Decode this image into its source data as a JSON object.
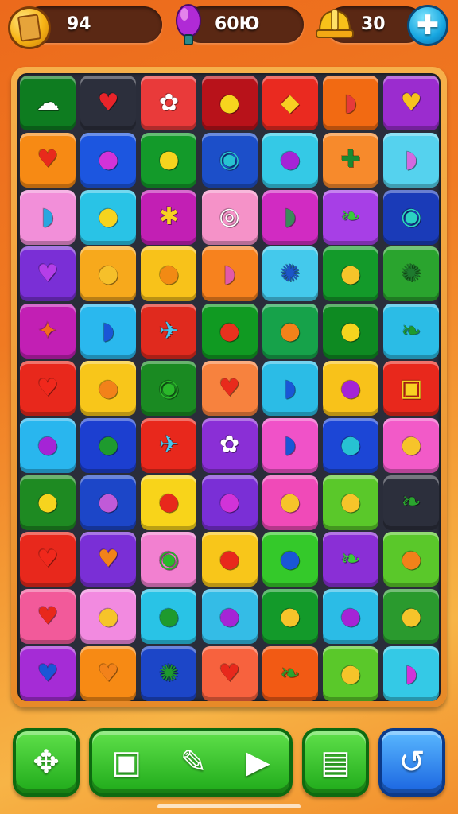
{
  "hud": {
    "coins": "94",
    "gems": "60Ю",
    "helmets": "30",
    "icons": {
      "coins": "gold-coin-icon",
      "gems": "purple-gem-icon",
      "helmets": "hard-hat-icon",
      "add": "plus-icon"
    }
  },
  "board": {
    "rows": 11,
    "cols": 7,
    "tiles": [
      [
        {
          "bg": "#0e7c20",
          "piece": "☁",
          "fg": "#ffffff"
        },
        {
          "bg": "#2c2f3c",
          "piece": "♥",
          "fg": "#e8242a"
        },
        {
          "bg": "#e93a3a",
          "piece": "✿",
          "fg": "#ffffff"
        },
        {
          "bg": "#b8121a",
          "piece": "●",
          "fg": "#f6d41e"
        },
        {
          "bg": "#ea2a20",
          "piece": "◆",
          "fg": "#f8d022"
        },
        {
          "bg": "#f26a12",
          "piece": "◗",
          "fg": "#e63a3a"
        },
        {
          "bg": "#9b2ccf",
          "piece": "♥",
          "fg": "#f7c21e"
        }
      ],
      [
        {
          "bg": "#f78a14",
          "piece": "♥",
          "fg": "#e82a1c"
        },
        {
          "bg": "#1c56e0",
          "piece": "●",
          "fg": "#d233d8"
        },
        {
          "bg": "#139a2a",
          "piece": "●",
          "fg": "#f6d41e"
        },
        {
          "bg": "#1c4fc9",
          "piece": "◉",
          "fg": "#27c2d2"
        },
        {
          "bg": "#34c9e6",
          "piece": "●",
          "fg": "#a524d6"
        },
        {
          "bg": "#f78a2c",
          "piece": "✚",
          "fg": "#1c8a32"
        },
        {
          "bg": "#55d2ee",
          "piece": "◗",
          "fg": "#d26ae0"
        }
      ],
      [
        {
          "bg": "#f28fd9",
          "piece": "◗",
          "fg": "#28a6e0"
        },
        {
          "bg": "#29c3e6",
          "piece": "●",
          "fg": "#f6d41e"
        },
        {
          "bg": "#c21fb4",
          "piece": "✱",
          "fg": "#f8d022"
        },
        {
          "bg": "#f592c8",
          "piece": "◎",
          "fg": "#ffffff"
        },
        {
          "bg": "#d12bc2",
          "piece": "◗",
          "fg": "#3a8a5a"
        },
        {
          "bg": "#a73fe6",
          "piece": "❧",
          "fg": "#3aca3a"
        },
        {
          "bg": "#1a3bb8",
          "piece": "◉",
          "fg": "#2bd2c2"
        }
      ],
      [
        {
          "bg": "#7a2fd6",
          "piece": "♥",
          "fg": "#b53ee8"
        },
        {
          "bg": "#f7a91c",
          "piece": "●",
          "fg": "#f6c02a"
        },
        {
          "bg": "#f8c21a",
          "piece": "●",
          "fg": "#f28a14"
        },
        {
          "bg": "#f7821e",
          "piece": "◗",
          "fg": "#e25aa8"
        },
        {
          "bg": "#44c9ec",
          "piece": "✺",
          "fg": "#1c56c8"
        },
        {
          "bg": "#139a2a",
          "piece": "●",
          "fg": "#f6c42a"
        },
        {
          "bg": "#2aa42e",
          "piece": "✺",
          "fg": "#1e7a2e"
        }
      ],
      [
        {
          "bg": "#c21fb4",
          "piece": "✦",
          "fg": "#f26a1e"
        },
        {
          "bg": "#2ab8ee",
          "piece": "◗",
          "fg": "#1a56d6"
        },
        {
          "bg": "#e02a1e",
          "piece": "✈",
          "fg": "#46c8f0"
        },
        {
          "bg": "#109a22",
          "piece": "●",
          "fg": "#e8321e"
        },
        {
          "bg": "#16a24a",
          "piece": "●",
          "fg": "#f2821a"
        },
        {
          "bg": "#0e8a22",
          "piece": "●",
          "fg": "#f6d41e"
        },
        {
          "bg": "#2bbce6",
          "piece": "❧",
          "fg": "#1e9a2e"
        }
      ],
      [
        {
          "bg": "#e8281c",
          "piece": "♥",
          "fg": "#f0281c"
        },
        {
          "bg": "#f8c61a",
          "piece": "●",
          "fg": "#f2821a"
        },
        {
          "bg": "#1a8a22",
          "piece": "◉",
          "fg": "#2ab82a"
        },
        {
          "bg": "#f7823e",
          "piece": "♥",
          "fg": "#e82a1c"
        },
        {
          "bg": "#2bbce6",
          "piece": "◗",
          "fg": "#1a56d6"
        },
        {
          "bg": "#f8c21a",
          "piece": "●",
          "fg": "#a524d6"
        },
        {
          "bg": "#e8281c",
          "piece": "▣",
          "fg": "#f8d022"
        }
      ],
      [
        {
          "bg": "#29b6ee",
          "piece": "●",
          "fg": "#a524d6"
        },
        {
          "bg": "#1c3fd0",
          "piece": "●",
          "fg": "#1e9a2e"
        },
        {
          "bg": "#e8281c",
          "piece": "✈",
          "fg": "#46c8f0"
        },
        {
          "bg": "#8a2fd6",
          "piece": "✿",
          "fg": "#ffffff"
        },
        {
          "bg": "#f052c8",
          "piece": "◗",
          "fg": "#1a56d6"
        },
        {
          "bg": "#1c46d6",
          "piece": "●",
          "fg": "#27c2d2"
        },
        {
          "bg": "#f25ac8",
          "piece": "●",
          "fg": "#f6c42a"
        }
      ],
      [
        {
          "bg": "#1e8a22",
          "piece": "●",
          "fg": "#f6d41e"
        },
        {
          "bg": "#1c46c8",
          "piece": "●",
          "fg": "#c05ad8"
        },
        {
          "bg": "#f8d41a",
          "piece": "●",
          "fg": "#e8281c"
        },
        {
          "bg": "#7a2fd6",
          "piece": "●",
          "fg": "#d233d8"
        },
        {
          "bg": "#f04ab8",
          "piece": "●",
          "fg": "#f6c42a"
        },
        {
          "bg": "#5ac82a",
          "piece": "●",
          "fg": "#f6c42a"
        },
        {
          "bg": "#2c2f3c",
          "piece": "❧",
          "fg": "#2aa42e"
        }
      ],
      [
        {
          "bg": "#e8281c",
          "piece": "♥",
          "fg": "#f0281c"
        },
        {
          "bg": "#7a2fd6",
          "piece": "♥",
          "fg": "#f2821a"
        },
        {
          "bg": "#f280d0",
          "piece": "◉",
          "fg": "#2ab82a"
        },
        {
          "bg": "#f8c61a",
          "piece": "●",
          "fg": "#e8281c"
        },
        {
          "bg": "#34c92a",
          "piece": "●",
          "fg": "#1a56d6"
        },
        {
          "bg": "#8a2fd6",
          "piece": "❧",
          "fg": "#3aca3a"
        },
        {
          "bg": "#5ac82a",
          "piece": "●",
          "fg": "#f2821a"
        }
      ],
      [
        {
          "bg": "#f25a9a",
          "piece": "♥",
          "fg": "#e8281c"
        },
        {
          "bg": "#f28ae0",
          "piece": "●",
          "fg": "#f6c42a"
        },
        {
          "bg": "#29c3e6",
          "piece": "●",
          "fg": "#1e9a2e"
        },
        {
          "bg": "#34bce6",
          "piece": "●",
          "fg": "#a524d6"
        },
        {
          "bg": "#139a2a",
          "piece": "●",
          "fg": "#f6c42a"
        },
        {
          "bg": "#2bbce6",
          "piece": "●",
          "fg": "#a524d6"
        },
        {
          "bg": "#2a9a2e",
          "piece": "●",
          "fg": "#f6c42a"
        }
      ],
      [
        {
          "bg": "#a52cd6",
          "piece": "♥",
          "fg": "#1a56d6"
        },
        {
          "bg": "#f78a14",
          "piece": "♥",
          "fg": "#f2821a"
        },
        {
          "bg": "#1c46c8",
          "piece": "✺",
          "fg": "#1e9a2e"
        },
        {
          "bg": "#f7623e",
          "piece": "♥",
          "fg": "#e8281c"
        },
        {
          "bg": "#f25a14",
          "piece": "❧",
          "fg": "#2aa42e"
        },
        {
          "bg": "#5ac82a",
          "piece": "●",
          "fg": "#f6c42a"
        },
        {
          "bg": "#34c9e6",
          "piece": "◗",
          "fg": "#d233d8"
        }
      ]
    ]
  },
  "toolbar": {
    "buttons": [
      {
        "name": "shuffle-button",
        "icon": "puzzle-piece-icon",
        "glyph": "✥"
      },
      {
        "name": "hammer-button",
        "icon": "frame-icon",
        "glyph": "▣"
      },
      {
        "name": "brush-button",
        "icon": "brush-icon",
        "glyph": "✎"
      },
      {
        "name": "play-button",
        "icon": "play-icon",
        "glyph": "▶"
      },
      {
        "name": "shop-button",
        "icon": "chest-icon",
        "glyph": "▤"
      },
      {
        "name": "undo-button",
        "icon": "undo-icon",
        "glyph": "↺"
      }
    ]
  }
}
